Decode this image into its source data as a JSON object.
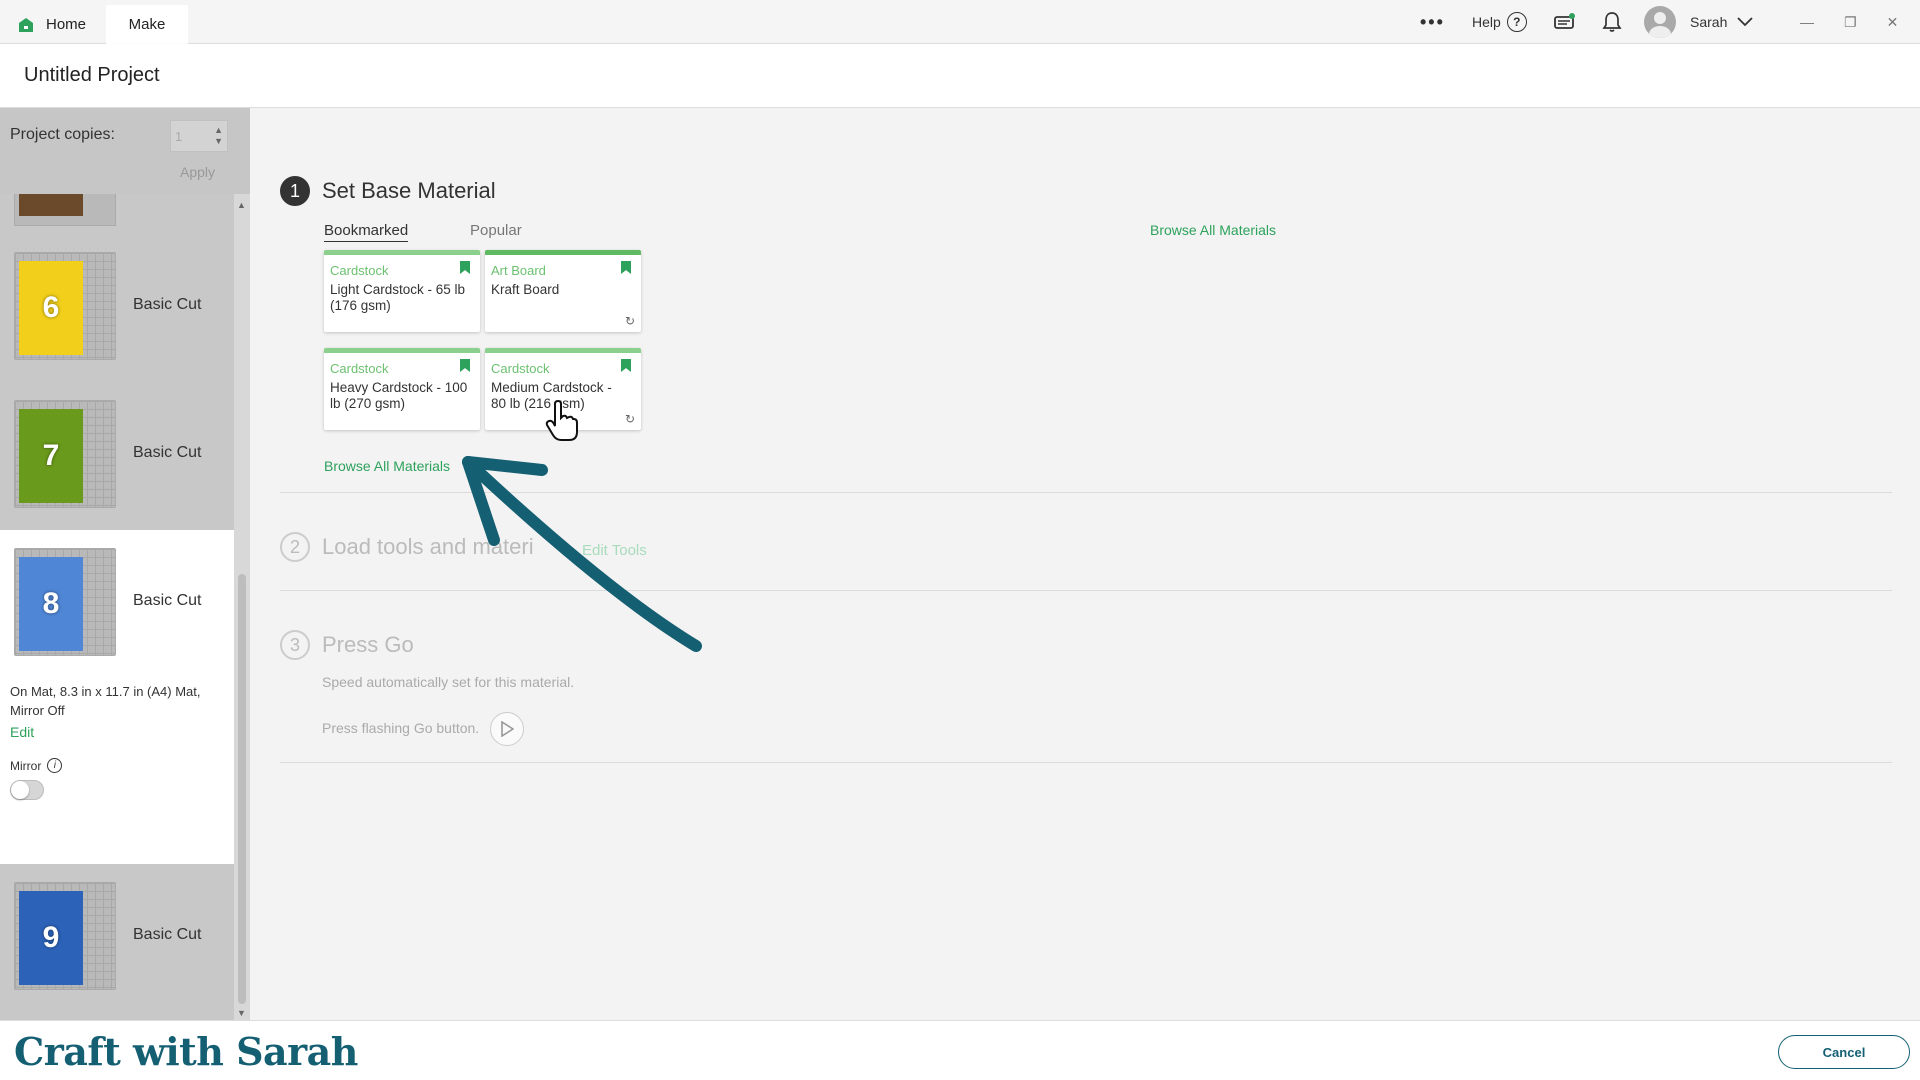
{
  "tabs": {
    "home": "Home",
    "make": "Make"
  },
  "header": {
    "more": "•••",
    "help": "Help",
    "help_glyph": "?",
    "user_name": "Sarah",
    "window_controls": [
      "—",
      "❐",
      "✕"
    ]
  },
  "project": {
    "title": "Untitled Project"
  },
  "sidebar": {
    "copies_label": "Project copies:",
    "copies_value": "1",
    "apply": "Apply",
    "mats": [
      {
        "number": "6",
        "label": "Basic Cut",
        "color": "#f1cf1a"
      },
      {
        "number": "7",
        "label": "Basic Cut",
        "color": "#6a9a1c"
      },
      {
        "number": "8",
        "label": "Basic Cut",
        "color": "#4f86d6"
      },
      {
        "number": "9",
        "label": "Basic Cut",
        "color": "#2c62b8"
      }
    ],
    "partial_mat_color": "#6b4a2b",
    "active_info": "On Mat, 8.3 in x 11.7 in (A4) Mat, Mirror Off",
    "edit": "Edit",
    "mirror": "Mirror",
    "mirror_on": false
  },
  "steps": {
    "s1": {
      "number": "1",
      "title": "Set Base Material"
    },
    "s2": {
      "number": "2",
      "title": "Load tools and materi",
      "edit_tools": "Edit Tools"
    },
    "s3": {
      "number": "3",
      "title": "Press Go",
      "speed": "Speed automatically set for this material.",
      "press_flash": "Press flashing Go button."
    }
  },
  "material_tabs": {
    "bookmarked": "Bookmarked",
    "popular": "Popular"
  },
  "browse_all": "Browse All Materials",
  "cards": [
    {
      "category": "Cardstock",
      "name": "Light Cardstock - 65 lb (176 gsm)",
      "refresh": false
    },
    {
      "category": "Art Board",
      "name": "Kraft Board",
      "refresh": true
    },
    {
      "category": "Cardstock",
      "name": "Heavy Cardstock - 100 lb (270 gsm)",
      "refresh": false
    },
    {
      "category": "Cardstock",
      "name": "Medium Cardstock - 80 lb (216 gsm)",
      "refresh": true
    }
  ],
  "footer": {
    "brand": "Craft with Sarah",
    "cancel": "Cancel"
  },
  "colors": {
    "accent_green": "#2da25c",
    "brand_teal": "#155f73",
    "card_top": "#8bd08d"
  },
  "icons": {
    "refresh": "↻",
    "spinner_up": "▲",
    "spinner_down": "▼"
  }
}
